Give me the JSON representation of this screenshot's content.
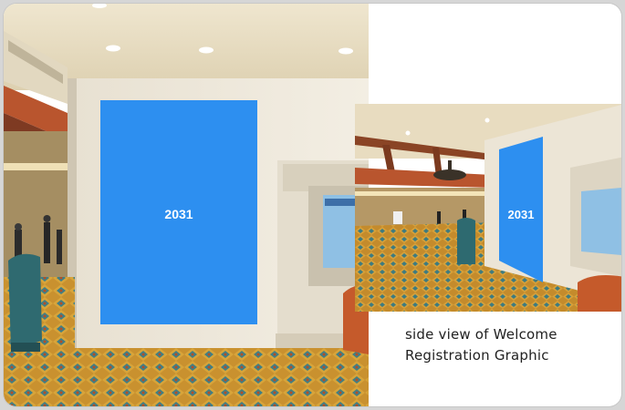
{
  "main_photo": {
    "sign_label": "2031",
    "sign_color": "#2d8ff0"
  },
  "inset_photo": {
    "sign_label": "2031",
    "sign_color": "#2d8ff0"
  },
  "caption": {
    "line1": "side view of Welcome",
    "line2": "Registration Graphic"
  }
}
